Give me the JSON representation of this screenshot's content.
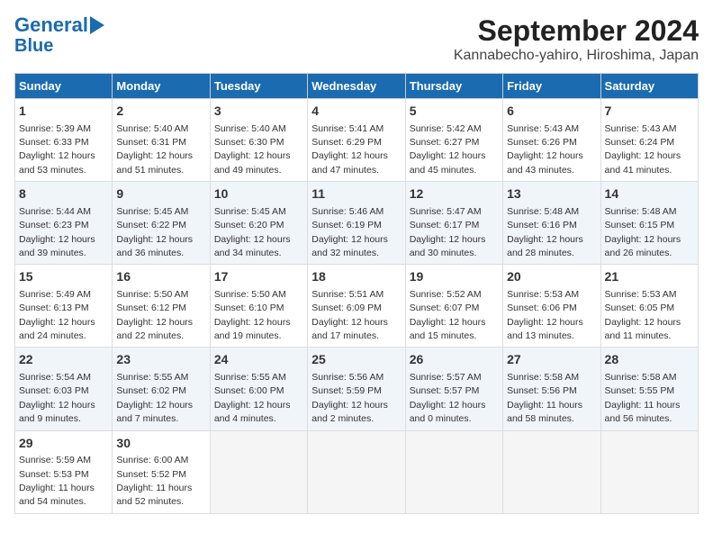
{
  "logo": {
    "line1": "General",
    "line2": "Blue"
  },
  "title": "September 2024",
  "subtitle": "Kannabecho-yahiro, Hiroshima, Japan",
  "weekdays": [
    "Sunday",
    "Monday",
    "Tuesday",
    "Wednesday",
    "Thursday",
    "Friday",
    "Saturday"
  ],
  "weeks": [
    [
      {
        "day": "1",
        "sunrise": "Sunrise: 5:39 AM",
        "sunset": "Sunset: 6:33 PM",
        "daylight": "Daylight: 12 hours and 53 minutes."
      },
      {
        "day": "2",
        "sunrise": "Sunrise: 5:40 AM",
        "sunset": "Sunset: 6:31 PM",
        "daylight": "Daylight: 12 hours and 51 minutes."
      },
      {
        "day": "3",
        "sunrise": "Sunrise: 5:40 AM",
        "sunset": "Sunset: 6:30 PM",
        "daylight": "Daylight: 12 hours and 49 minutes."
      },
      {
        "day": "4",
        "sunrise": "Sunrise: 5:41 AM",
        "sunset": "Sunset: 6:29 PM",
        "daylight": "Daylight: 12 hours and 47 minutes."
      },
      {
        "day": "5",
        "sunrise": "Sunrise: 5:42 AM",
        "sunset": "Sunset: 6:27 PM",
        "daylight": "Daylight: 12 hours and 45 minutes."
      },
      {
        "day": "6",
        "sunrise": "Sunrise: 5:43 AM",
        "sunset": "Sunset: 6:26 PM",
        "daylight": "Daylight: 12 hours and 43 minutes."
      },
      {
        "day": "7",
        "sunrise": "Sunrise: 5:43 AM",
        "sunset": "Sunset: 6:24 PM",
        "daylight": "Daylight: 12 hours and 41 minutes."
      }
    ],
    [
      {
        "day": "8",
        "sunrise": "Sunrise: 5:44 AM",
        "sunset": "Sunset: 6:23 PM",
        "daylight": "Daylight: 12 hours and 39 minutes."
      },
      {
        "day": "9",
        "sunrise": "Sunrise: 5:45 AM",
        "sunset": "Sunset: 6:22 PM",
        "daylight": "Daylight: 12 hours and 36 minutes."
      },
      {
        "day": "10",
        "sunrise": "Sunrise: 5:45 AM",
        "sunset": "Sunset: 6:20 PM",
        "daylight": "Daylight: 12 hours and 34 minutes."
      },
      {
        "day": "11",
        "sunrise": "Sunrise: 5:46 AM",
        "sunset": "Sunset: 6:19 PM",
        "daylight": "Daylight: 12 hours and 32 minutes."
      },
      {
        "day": "12",
        "sunrise": "Sunrise: 5:47 AM",
        "sunset": "Sunset: 6:17 PM",
        "daylight": "Daylight: 12 hours and 30 minutes."
      },
      {
        "day": "13",
        "sunrise": "Sunrise: 5:48 AM",
        "sunset": "Sunset: 6:16 PM",
        "daylight": "Daylight: 12 hours and 28 minutes."
      },
      {
        "day": "14",
        "sunrise": "Sunrise: 5:48 AM",
        "sunset": "Sunset: 6:15 PM",
        "daylight": "Daylight: 12 hours and 26 minutes."
      }
    ],
    [
      {
        "day": "15",
        "sunrise": "Sunrise: 5:49 AM",
        "sunset": "Sunset: 6:13 PM",
        "daylight": "Daylight: 12 hours and 24 minutes."
      },
      {
        "day": "16",
        "sunrise": "Sunrise: 5:50 AM",
        "sunset": "Sunset: 6:12 PM",
        "daylight": "Daylight: 12 hours and 22 minutes."
      },
      {
        "day": "17",
        "sunrise": "Sunrise: 5:50 AM",
        "sunset": "Sunset: 6:10 PM",
        "daylight": "Daylight: 12 hours and 19 minutes."
      },
      {
        "day": "18",
        "sunrise": "Sunrise: 5:51 AM",
        "sunset": "Sunset: 6:09 PM",
        "daylight": "Daylight: 12 hours and 17 minutes."
      },
      {
        "day": "19",
        "sunrise": "Sunrise: 5:52 AM",
        "sunset": "Sunset: 6:07 PM",
        "daylight": "Daylight: 12 hours and 15 minutes."
      },
      {
        "day": "20",
        "sunrise": "Sunrise: 5:53 AM",
        "sunset": "Sunset: 6:06 PM",
        "daylight": "Daylight: 12 hours and 13 minutes."
      },
      {
        "day": "21",
        "sunrise": "Sunrise: 5:53 AM",
        "sunset": "Sunset: 6:05 PM",
        "daylight": "Daylight: 12 hours and 11 minutes."
      }
    ],
    [
      {
        "day": "22",
        "sunrise": "Sunrise: 5:54 AM",
        "sunset": "Sunset: 6:03 PM",
        "daylight": "Daylight: 12 hours and 9 minutes."
      },
      {
        "day": "23",
        "sunrise": "Sunrise: 5:55 AM",
        "sunset": "Sunset: 6:02 PM",
        "daylight": "Daylight: 12 hours and 7 minutes."
      },
      {
        "day": "24",
        "sunrise": "Sunrise: 5:55 AM",
        "sunset": "Sunset: 6:00 PM",
        "daylight": "Daylight: 12 hours and 4 minutes."
      },
      {
        "day": "25",
        "sunrise": "Sunrise: 5:56 AM",
        "sunset": "Sunset: 5:59 PM",
        "daylight": "Daylight: 12 hours and 2 minutes."
      },
      {
        "day": "26",
        "sunrise": "Sunrise: 5:57 AM",
        "sunset": "Sunset: 5:57 PM",
        "daylight": "Daylight: 12 hours and 0 minutes."
      },
      {
        "day": "27",
        "sunrise": "Sunrise: 5:58 AM",
        "sunset": "Sunset: 5:56 PM",
        "daylight": "Daylight: 11 hours and 58 minutes."
      },
      {
        "day": "28",
        "sunrise": "Sunrise: 5:58 AM",
        "sunset": "Sunset: 5:55 PM",
        "daylight": "Daylight: 11 hours and 56 minutes."
      }
    ],
    [
      {
        "day": "29",
        "sunrise": "Sunrise: 5:59 AM",
        "sunset": "Sunset: 5:53 PM",
        "daylight": "Daylight: 11 hours and 54 minutes."
      },
      {
        "day": "30",
        "sunrise": "Sunrise: 6:00 AM",
        "sunset": "Sunset: 5:52 PM",
        "daylight": "Daylight: 11 hours and 52 minutes."
      },
      null,
      null,
      null,
      null,
      null
    ]
  ]
}
